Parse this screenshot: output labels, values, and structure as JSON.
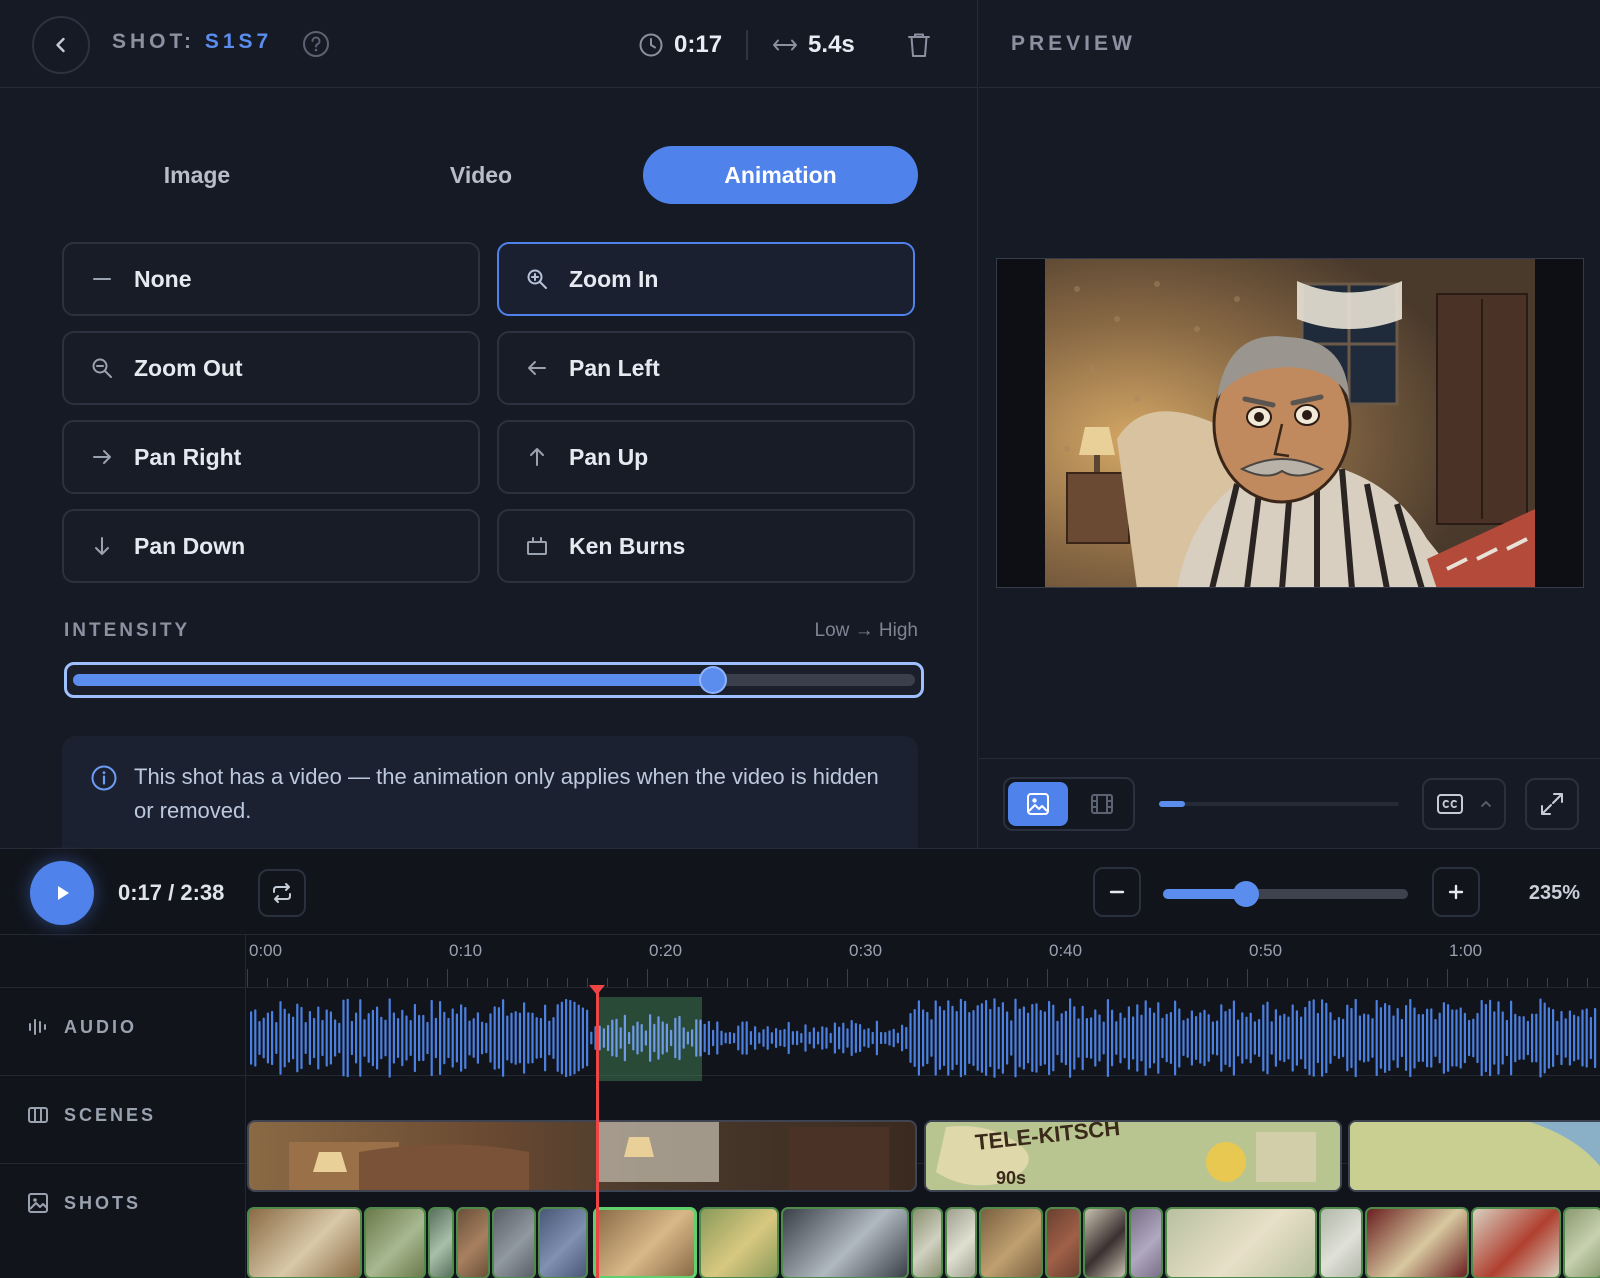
{
  "header": {
    "shot_prefix": "SHOT:",
    "shot_id": "S1S7",
    "time": "0:17",
    "duration": "5.4s"
  },
  "tabs": [
    {
      "label": "Image",
      "active": false
    },
    {
      "label": "Video",
      "active": false
    },
    {
      "label": "Animation",
      "active": true
    }
  ],
  "animations": [
    {
      "label": "None",
      "icon": "minus-icon",
      "selected": false
    },
    {
      "label": "Zoom In",
      "icon": "zoom-in-icon",
      "selected": true
    },
    {
      "label": "Zoom Out",
      "icon": "zoom-out-icon",
      "selected": false
    },
    {
      "label": "Pan Left",
      "icon": "arrow-left-icon",
      "selected": false
    },
    {
      "label": "Pan Right",
      "icon": "arrow-right-icon",
      "selected": false
    },
    {
      "label": "Pan Up",
      "icon": "arrow-up-icon",
      "selected": false
    },
    {
      "label": "Pan Down",
      "icon": "arrow-down-icon",
      "selected": false
    },
    {
      "label": "Ken Burns",
      "icon": "frame-icon",
      "selected": false
    }
  ],
  "intensity": {
    "label": "INTENSITY",
    "range_label": "Low → High",
    "value": 0.76
  },
  "info": {
    "message": "This shot has a video — the animation only applies when the video is hidden or removed."
  },
  "preview": {
    "title": "PREVIEW",
    "mode": "image",
    "scrub_progress": 0.11
  },
  "timeline": {
    "current": "0:17 / 2:38",
    "zoom": "235%",
    "zoom_value": 0.34,
    "ruler": [
      "0:00",
      "0:10",
      "0:20",
      "0:30",
      "0:40",
      "0:50",
      "1:00"
    ],
    "tracks": {
      "audio": "AUDIO",
      "scenes": "SCENES",
      "shots": "SHOTS"
    },
    "scene_texts": [
      "TELE-KITSCH",
      "90s"
    ]
  },
  "colors": {
    "accent": "#4f82ea",
    "playhead": "#ef4444",
    "active_shot": "#5fd06b",
    "waveform": "#4b7fe0"
  }
}
